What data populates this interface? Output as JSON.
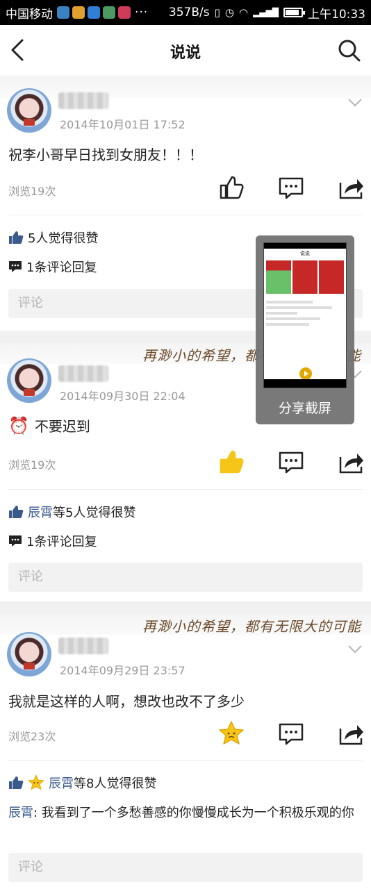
{
  "statusbar": {
    "carrier": "中国移动",
    "app_icon_colors": [
      "#3b82c4",
      "#e0a030",
      "#2f7fd6",
      "#4c9a62",
      "#d23a5a"
    ],
    "dots": "···",
    "speed": "357B/s",
    "network": "4G",
    "battery_level": 0.85,
    "time": "上午10:33"
  },
  "header": {
    "title": "说说",
    "back_icon": "back-arrow-icon",
    "search_icon": "search-icon"
  },
  "deco_text": "再渺小的希望，都有无限大的可能",
  "posts": [
    {
      "timestamp": "2014年10月01日 17:52",
      "content": "祝李小哥早日找到女朋友！！！",
      "views": "浏览19次",
      "liked": false,
      "likes_who": "",
      "likes_text": "5人觉得很赞",
      "comments_text": "1条评论回复",
      "comment_placeholder": "评论"
    },
    {
      "timestamp": "2014年09月30日 22:04",
      "content_emoji": "⏰",
      "content": "不要迟到",
      "views": "浏览19次",
      "liked": true,
      "likes_who": "辰霄",
      "likes_text": "等5人觉得很赞",
      "comments_text": "1条评论回复",
      "comment_placeholder": "评论"
    },
    {
      "timestamp": "2014年09月29日 23:57",
      "content": "我就是这样的人啊，想改也改不了多少",
      "views": "浏览23次",
      "liked": true,
      "likes_who": "辰霄",
      "likes_text": "等8人觉得很赞",
      "comment_author": "辰霄",
      "comment_text": ": 我看到了一个多愁善感的你慢慢成长为一个积极乐观的你",
      "comment_placeholder": "评论"
    }
  ],
  "share_overlay": {
    "label": "分享截屏",
    "thumb_title": "说说"
  },
  "colors": {
    "accent_blue": "#3a5a8c",
    "liked_yellow": "#f5c518",
    "icon_dark": "#222222"
  }
}
